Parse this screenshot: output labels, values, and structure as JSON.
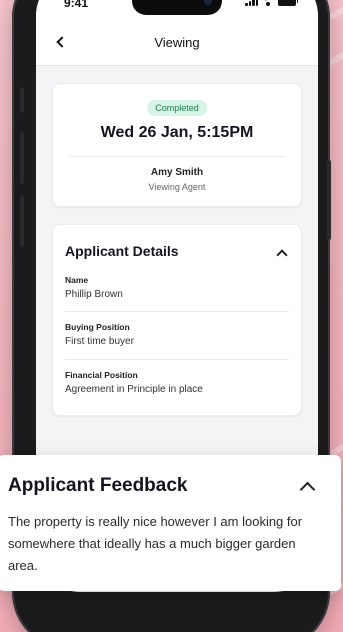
{
  "status_bar": {
    "time": "9:41"
  },
  "nav": {
    "title": "Viewing"
  },
  "viewing": {
    "status": "Completed",
    "date": "Wed 26 Jan, 5:15PM",
    "agent_name": "Amy Smith",
    "agent_role": "Viewing Agent"
  },
  "applicant": {
    "title": "Applicant Details",
    "fields": [
      {
        "label": "Name",
        "value": "Phillip Brown"
      },
      {
        "label": "Buying Position",
        "value": "First time buyer"
      },
      {
        "label": "Financial Position",
        "value": "Agreement in Principle in place"
      }
    ]
  },
  "feedback": {
    "title": "Applicant Feedback",
    "text": "The property is really nice however I am looking for somewhere that ideally has a much bigger garden area."
  },
  "colors": {
    "background": "#f6b7c0",
    "badge_bg": "#d6f5e6",
    "badge_text": "#1f7a4e",
    "text_primary": "#141420"
  },
  "icons": [
    "signal-icon",
    "wifi-icon",
    "battery-icon",
    "back-chevron-icon",
    "chevron-up-icon"
  ]
}
